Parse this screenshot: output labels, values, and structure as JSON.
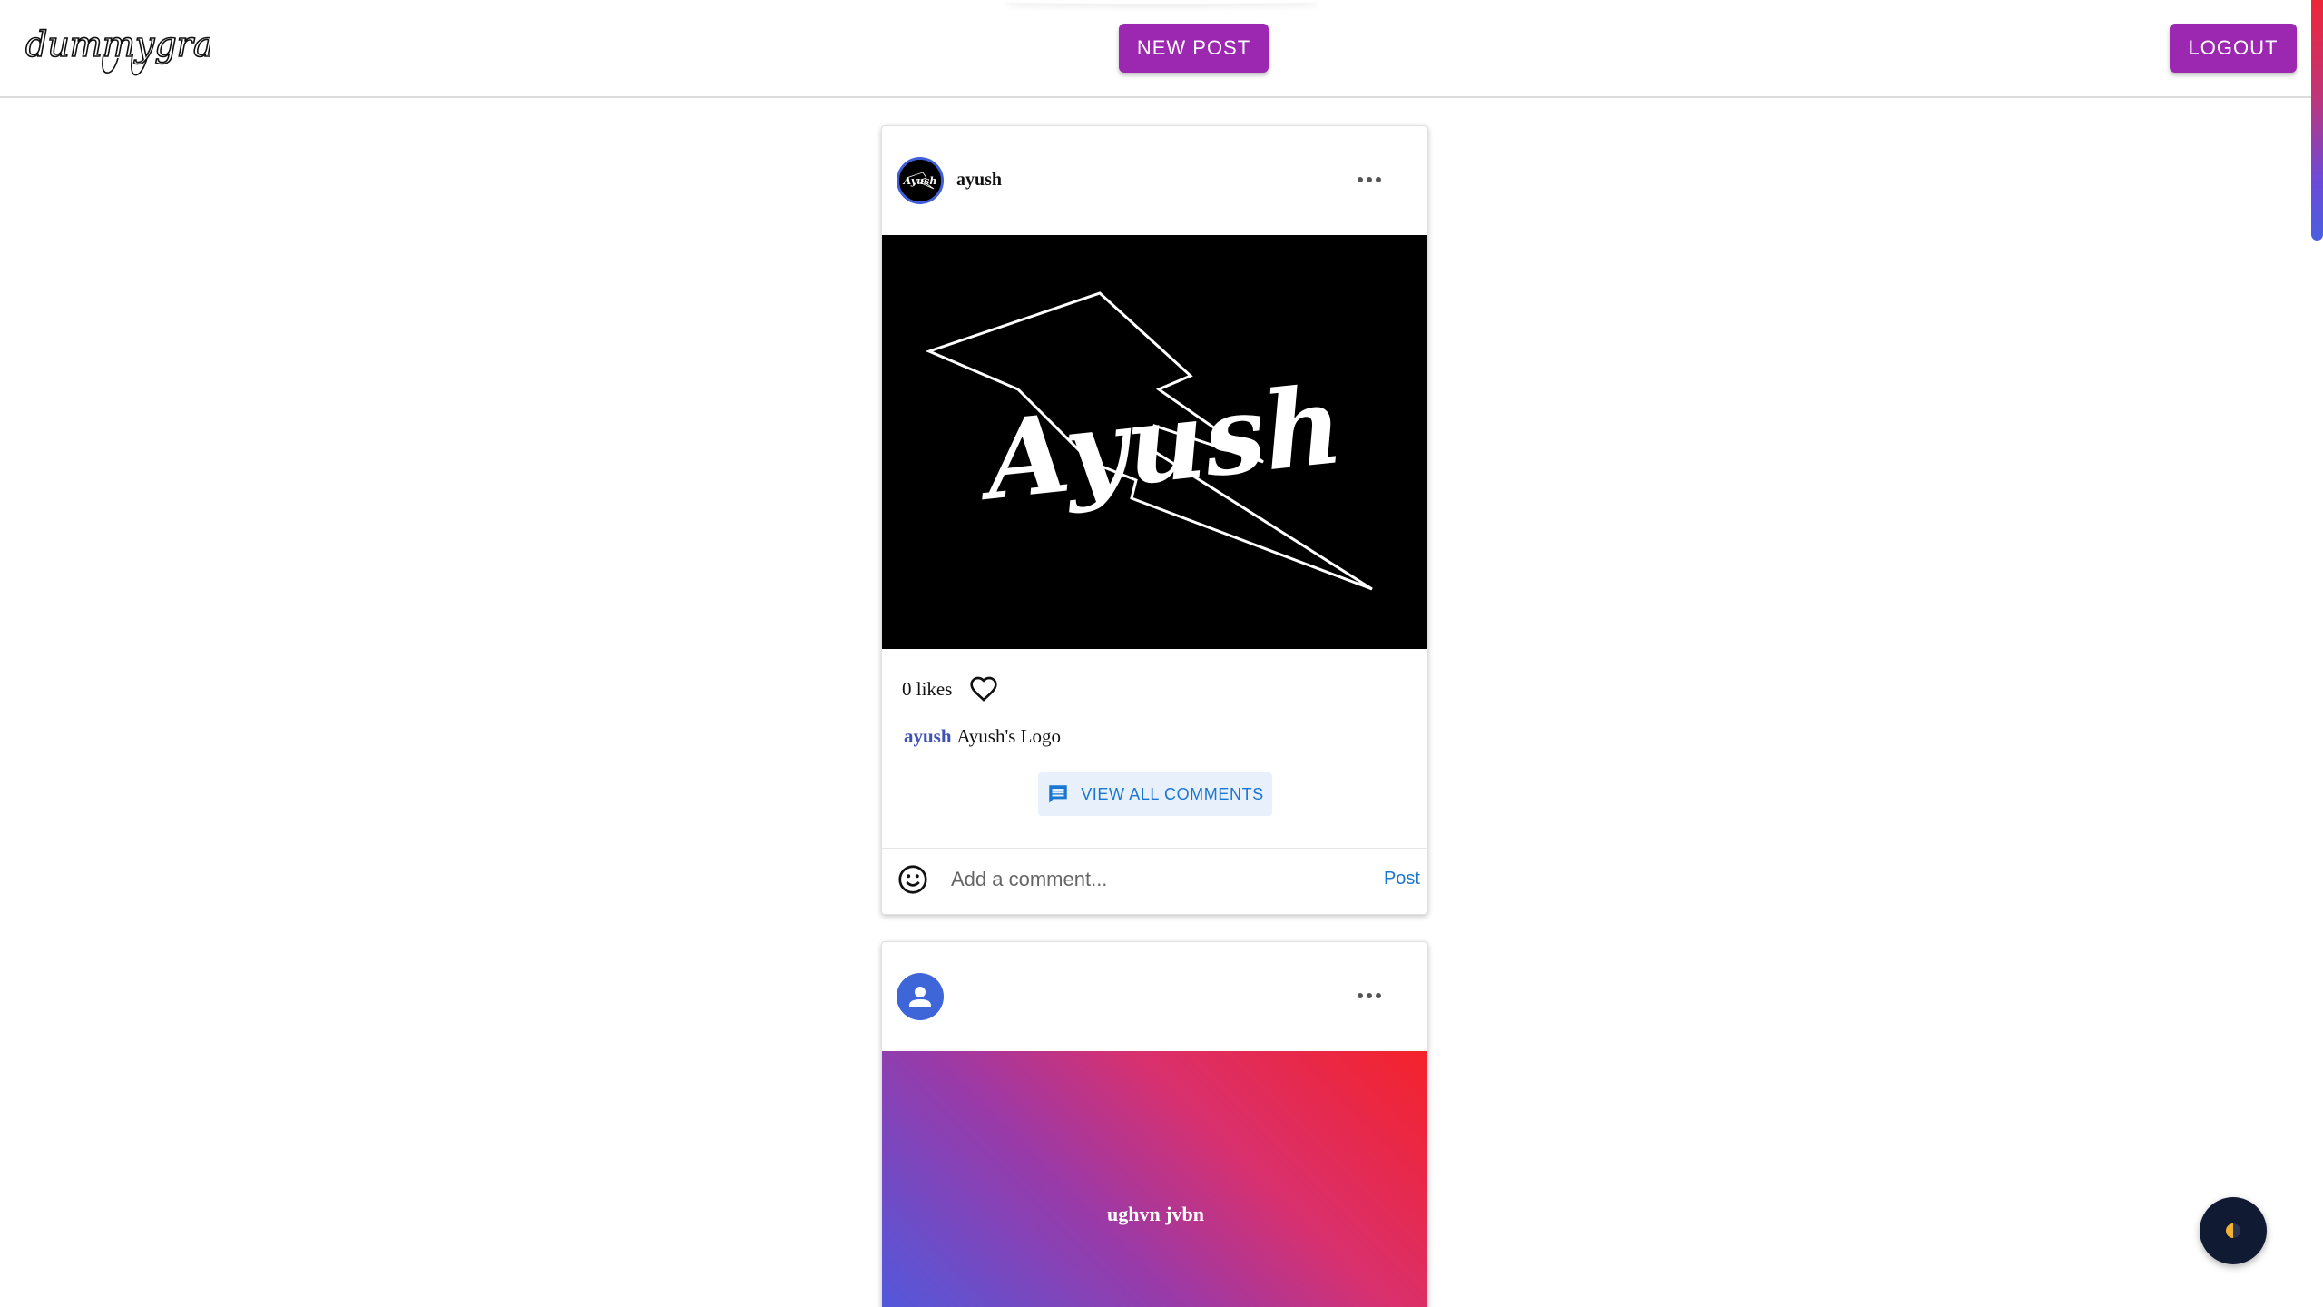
{
  "header": {
    "logo_text": "dummygram",
    "new_post_label": "NEW POST",
    "logout_label": "LOGOUT"
  },
  "posts": [
    {
      "username": "ayush",
      "avatar_text": "Ayush",
      "image_text": "Ayush",
      "likes": "0 likes",
      "caption_user": "ayush",
      "caption_text": "Ayush's Logo",
      "view_comments_label": "VIEW ALL COMMENTS",
      "comment_placeholder": "Add a comment...",
      "post_label": "Post"
    },
    {
      "username": "",
      "image_text": "ughvn jvbn"
    }
  ],
  "icons": {
    "more": "more-horizontal-icon",
    "like": "heart-outline-icon",
    "comments": "comment-icon",
    "emoji": "smiley-icon",
    "theme": "half-circle-icon",
    "default_avatar": "user-icon"
  },
  "colors": {
    "accent": "#9c27b0",
    "link": "#1976d2",
    "caption_user": "#3f51b5",
    "toggle_bg": "#111a33"
  }
}
